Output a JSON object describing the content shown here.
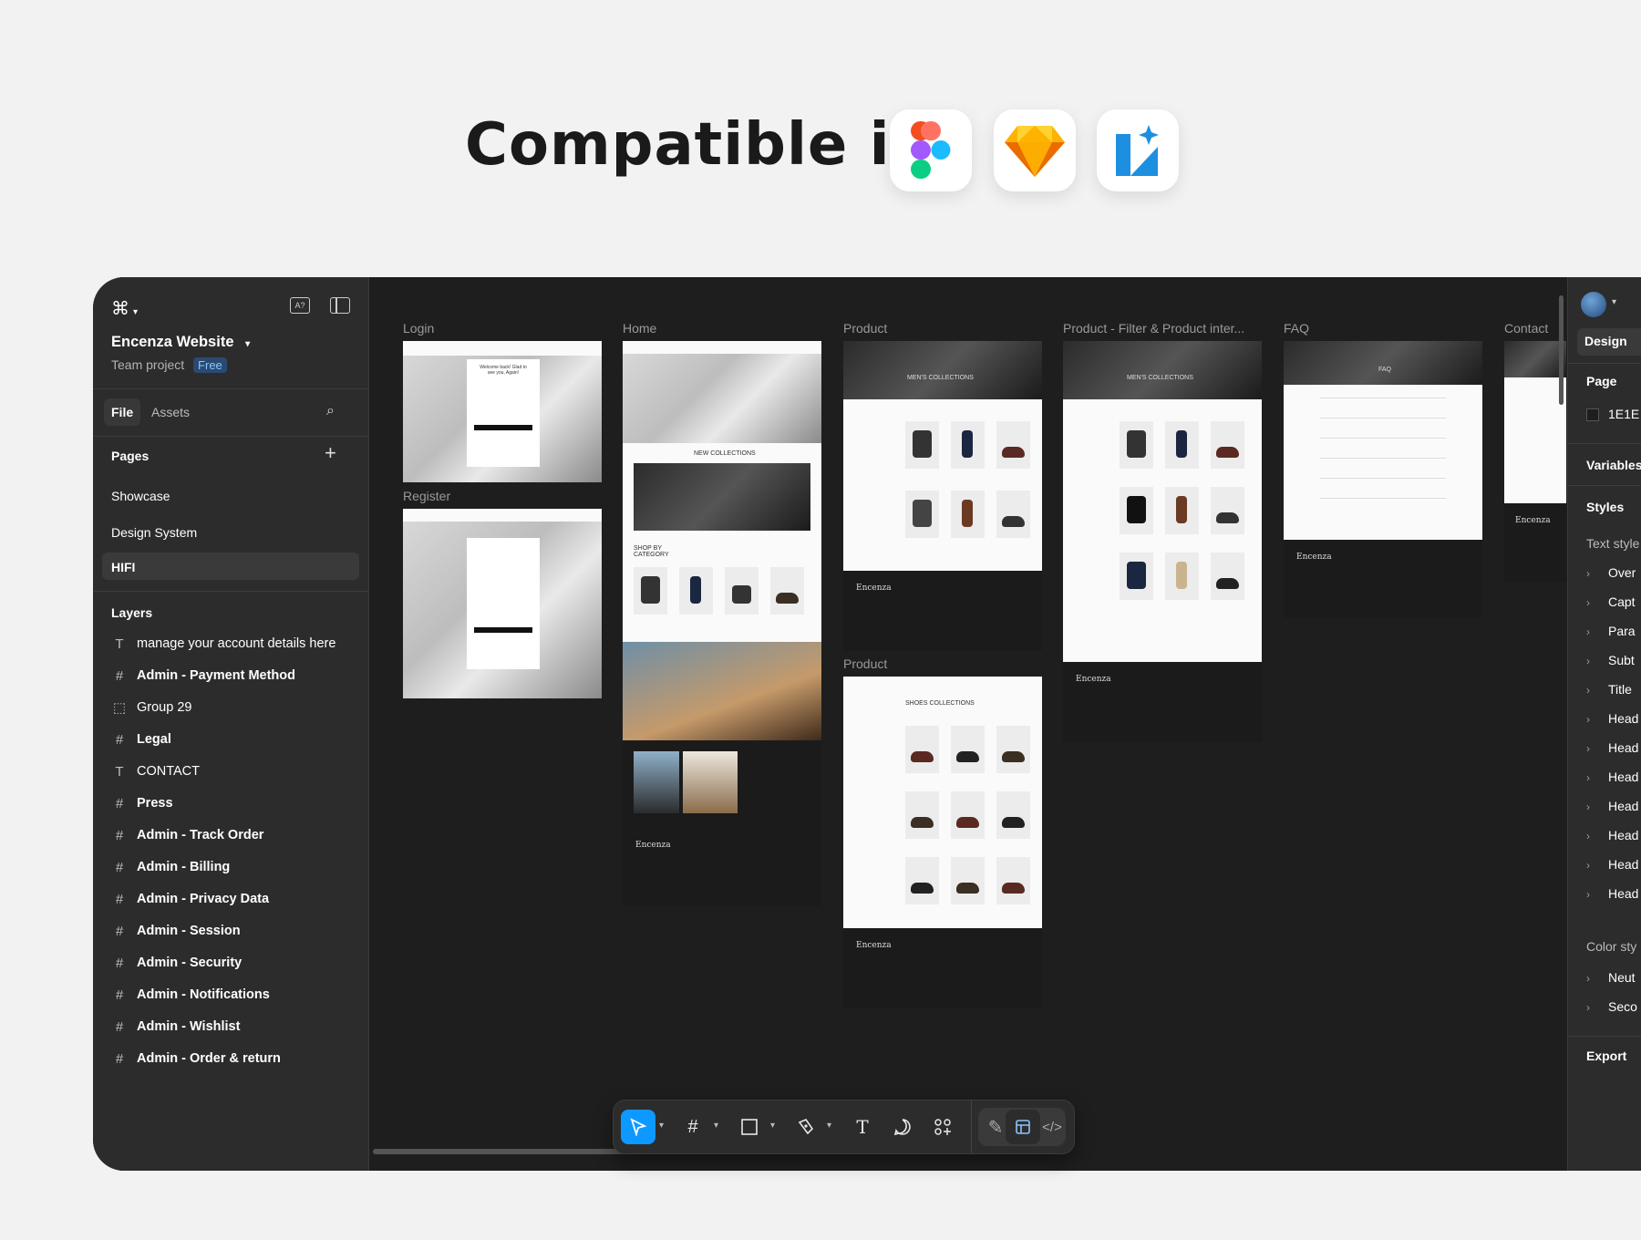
{
  "headline": "Compatible in",
  "app_icons": [
    "figma-logo",
    "sketch-logo",
    "lunacy-logo"
  ],
  "left": {
    "project_name": "Encenza Website",
    "team_label": "Team project",
    "plan_badge": "Free",
    "tabs": [
      "File",
      "Assets"
    ],
    "pages_title": "Pages",
    "pages": [
      "Showcase",
      "Design System",
      "HIFI"
    ],
    "layers_title": "Layers",
    "layers": [
      {
        "icon": "text-icon",
        "glyph": "T",
        "label": "manage your account details here",
        "bold": false
      },
      {
        "icon": "frame-icon",
        "glyph": "#",
        "label": "Admin - Payment Method",
        "bold": true
      },
      {
        "icon": "group-icon",
        "glyph": "⬚",
        "label": "Group 29",
        "bold": false
      },
      {
        "icon": "frame-icon",
        "glyph": "#",
        "label": "Legal",
        "bold": true
      },
      {
        "icon": "text-icon",
        "glyph": "T",
        "label": "CONTACT",
        "bold": false
      },
      {
        "icon": "frame-icon",
        "glyph": "#",
        "label": "Press",
        "bold": true
      },
      {
        "icon": "frame-icon",
        "glyph": "#",
        "label": "Admin - Track Order",
        "bold": true
      },
      {
        "icon": "frame-icon",
        "glyph": "#",
        "label": "Admin - Billing",
        "bold": true
      },
      {
        "icon": "frame-icon",
        "glyph": "#",
        "label": "Admin - Privacy Data",
        "bold": true
      },
      {
        "icon": "frame-icon",
        "glyph": "#",
        "label": "Admin - Session",
        "bold": true
      },
      {
        "icon": "frame-icon",
        "glyph": "#",
        "label": "Admin - Security",
        "bold": true
      },
      {
        "icon": "frame-icon",
        "glyph": "#",
        "label": "Admin - Notifications",
        "bold": true
      },
      {
        "icon": "frame-icon",
        "glyph": "#",
        "label": "Admin - Wishlist",
        "bold": true
      },
      {
        "icon": "frame-icon",
        "glyph": "#",
        "label": "Admin - Order & return",
        "bold": true
      }
    ]
  },
  "canvas": {
    "frames": {
      "login": "Login",
      "register": "Register",
      "home": "Home",
      "product": "Product",
      "product_filter": "Product - Filter & Product inter...",
      "faq": "FAQ",
      "contact": "Contact",
      "product2": "Product"
    },
    "texts": {
      "welcome": "Welcome back! Glad to see you, Again!",
      "new_collections": "NEW COLLECTIONS",
      "shop_by_category": "SHOP BY CATEGORY",
      "mens_collections": "MEN'S COLLECTIONS",
      "shoes_collections": "SHOES COLLECTIONS",
      "faq_title": "FAQ",
      "brand": "Encenza"
    }
  },
  "right": {
    "tab": "Design",
    "page_label": "Page",
    "page_color": "1E1E",
    "variables": "Variables",
    "styles": "Styles",
    "text_styles": "Text style",
    "text_items": [
      "Over",
      "Capt",
      "Para",
      "Subt",
      "Title",
      "Head",
      "Head",
      "Head",
      "Head",
      "Head",
      "Head",
      "Head"
    ],
    "color_styles": "Color sty",
    "color_items": [
      "Neut",
      "Seco"
    ],
    "export": "Export"
  }
}
